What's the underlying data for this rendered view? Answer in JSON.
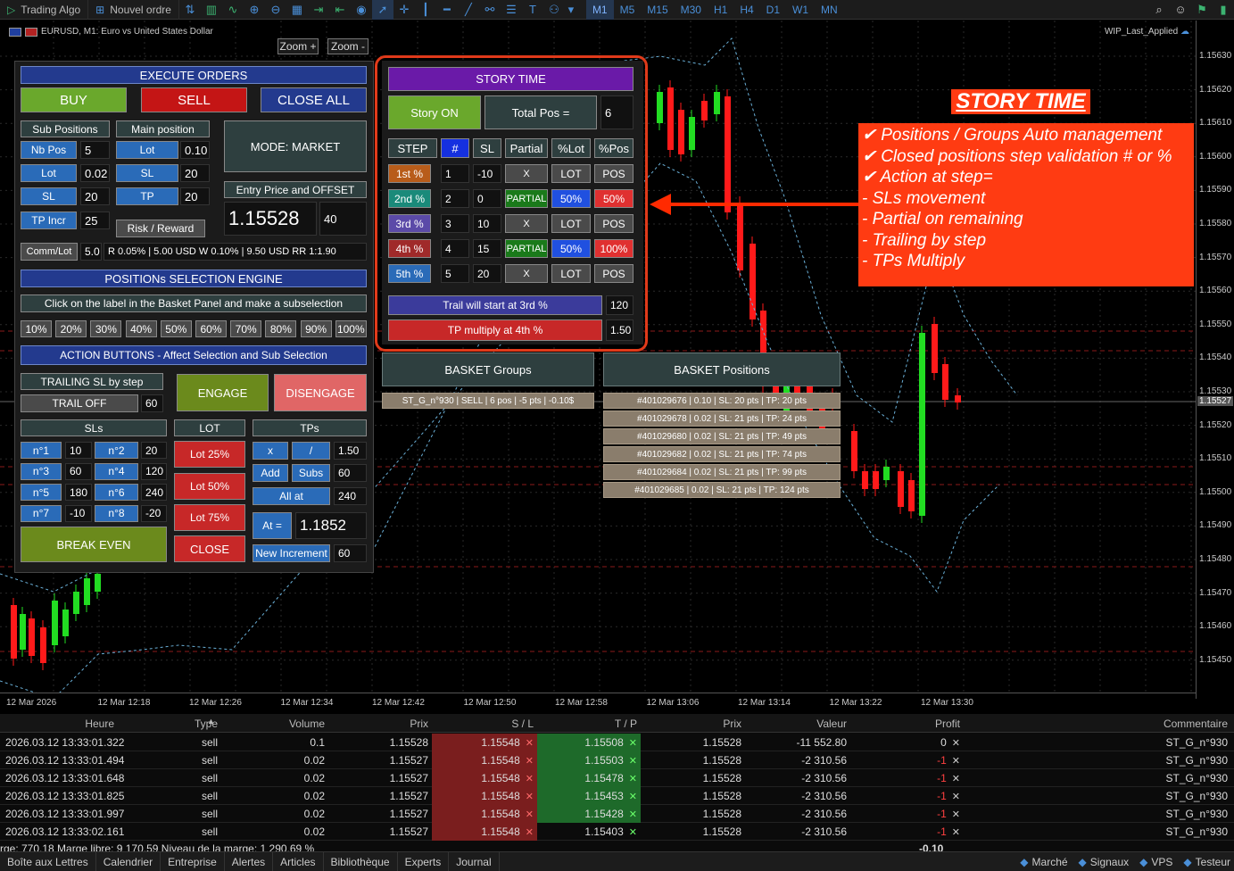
{
  "toolbar": {
    "trading_algo": "Trading Algo",
    "new_order": "Nouvel ordre",
    "timeframes": [
      "M1",
      "M5",
      "M15",
      "M30",
      "H1",
      "H4",
      "D1",
      "W1",
      "MN"
    ],
    "active_timeframe": "M1"
  },
  "chart": {
    "symbol_info": "EURUSD, M1:  Euro vs United States Dollar",
    "template": "WIP_Last_Applied",
    "zoom_in": "Zoom +",
    "zoom_out": "Zoom -",
    "price_labels": [
      "1.15630",
      "1.15620",
      "1.15610",
      "1.15600",
      "1.15590",
      "1.15580",
      "1.15570",
      "1.15560",
      "1.15550",
      "1.15540",
      "1.15530",
      "1.15520",
      "1.15510",
      "1.15500",
      "1.15490",
      "1.15480",
      "1.15470",
      "1.15460",
      "1.15450"
    ],
    "current_price": "1.15527",
    "time_labels": [
      "12 Mar 2026",
      "12 Mar 12:18",
      "12 Mar 12:26",
      "12 Mar 12:34",
      "12 Mar 12:42",
      "12 Mar 12:50",
      "12 Mar 12:58",
      "12 Mar 13:06",
      "12 Mar 13:14",
      "12 Mar 13:22",
      "12 Mar 13:30"
    ]
  },
  "execute": {
    "title": "EXECUTE ORDERS",
    "buy": "BUY",
    "sell": "SELL",
    "close_all": "CLOSE ALL",
    "sub_positions": "Sub Positions",
    "main_position": "Main position",
    "nb_pos_label": "Nb Pos",
    "nb_pos_value": "5",
    "lot_label": "Lot",
    "lot_value": "0.02",
    "sl_label": "SL",
    "sl_value": "20",
    "tp_incr_label": "TP Incr",
    "tp_incr_value": "25",
    "main_lot_label": "Lot",
    "main_lot_value": "0.10",
    "main_sl_label": "SL",
    "main_sl_value": "20",
    "main_tp_label": "TP",
    "main_tp_value": "20",
    "mode": "MODE: MARKET",
    "entry_price_offset": "Entry Price and OFFSET",
    "entry_price": "1.15528",
    "offset": "40",
    "risk_reward": "Risk / Reward",
    "comm_lot": "Comm/Lot",
    "comm_value": "5.0",
    "risk_summary": "R 0.05%  |  5.00 USD   W 0.10%  |  9.50 USD   RR 1:1.90"
  },
  "selection": {
    "title": "POSITIONs SELECTION ENGINE",
    "hint": "Click on the label in the Basket Panel and make a subselection",
    "percents": [
      "10%",
      "20%",
      "30%",
      "40%",
      "50%",
      "60%",
      "70%",
      "80%",
      "90%",
      "100%"
    ]
  },
  "actions": {
    "title": "ACTION BUTTONS - Affect Selection and Sub Selection",
    "trailing_sl": "TRAILING SL by step",
    "trail_off": "TRAIL OFF",
    "trail_value": "60",
    "engage": "ENGAGE",
    "disengage": "DISENGAGE",
    "sls_title": "SLs",
    "lot_title": "LOT",
    "tps_title": "TPs",
    "sl_grid": [
      {
        "l1": "n°1",
        "v1": "10",
        "l2": "n°2",
        "v2": "20"
      },
      {
        "l1": "n°3",
        "v1": "60",
        "l2": "n°4",
        "v2": "120"
      },
      {
        "l1": "n°5",
        "v1": "180",
        "l2": "n°6",
        "v2": "240"
      },
      {
        "l1": "n°7",
        "v1": "-10",
        "l2": "n°8",
        "v2": "-20"
      }
    ],
    "lot25": "Lot 25%",
    "lot50": "Lot 50%",
    "lot75": "Lot 75%",
    "close": "CLOSE",
    "tp_mul": "x",
    "tp_div": "/",
    "tp_mul_value": "1.50",
    "tp_add": "Add",
    "tp_subs": "Subs",
    "tp_add_value": "60",
    "tp_all_at": "All at",
    "tp_all_value": "240",
    "tp_at": "At =",
    "tp_at_value": "1.1852",
    "new_increment": "New Increment",
    "new_increment_value": "60",
    "break_even": "BREAK EVEN"
  },
  "story": {
    "title": "STORY TIME",
    "story_on": "Story ON",
    "total_pos": "Total Pos =",
    "total_pos_value": "6",
    "headers": [
      "STEP",
      "#",
      "SL",
      "Partial",
      "%Lot",
      "%Pos"
    ],
    "steps": [
      {
        "step": "1st %",
        "n": "1",
        "sl": "-10",
        "partial": "X",
        "lot": "LOT",
        "pos": "POS",
        "active": false
      },
      {
        "step": "2nd %",
        "n": "2",
        "sl": "0",
        "partial": "PARTIAL",
        "lot": "50%",
        "pos": "50%",
        "active": true
      },
      {
        "step": "3rd %",
        "n": "3",
        "sl": "10",
        "partial": "X",
        "lot": "LOT",
        "pos": "POS",
        "active": false
      },
      {
        "step": "4th %",
        "n": "4",
        "sl": "15",
        "partial": "PARTIAL",
        "lot": "50%",
        "pos": "100%",
        "active": true
      },
      {
        "step": "5th %",
        "n": "5",
        "sl": "20",
        "partial": "X",
        "lot": "LOT",
        "pos": "POS",
        "active": false
      }
    ],
    "trail_start": "Trail will start at 3rd %",
    "trail_start_value": "120",
    "tp_multiply": "TP multiply at 4th %",
    "tp_multiply_value": "1.50"
  },
  "basket": {
    "groups_title": "BASKET Groups",
    "positions_title": "BASKET Positions",
    "group_row": "ST_G_n°930 | SELL | 6 pos | -5 pts | -0.10$",
    "positions": [
      "#401029676 | 0.10 | SL: 20 pts | TP: 20 pts",
      "#401029678 | 0.02 | SL: 21 pts | TP: 24 pts",
      "#401029680 | 0.02 | SL: 21 pts | TP: 49 pts",
      "#401029682 | 0.02 | SL: 21 pts | TP: 74 pts",
      "#401029684 | 0.02 | SL: 21 pts | TP: 99 pts",
      "#401029685 | 0.02 | SL: 21 pts | TP: 124 pts"
    ]
  },
  "annotation": {
    "title": "STORY TIME",
    "lines": [
      "✔ Positions / Groups Auto management",
      "✔ Closed positions step validation # or %",
      "✔ Action at step=",
      " - SLs movement",
      " - Partial on remaining",
      " - Trailing by step",
      " - TPs Multiply"
    ]
  },
  "trades": {
    "headers": [
      "Heure",
      "Type",
      "Volume",
      "Prix",
      "S / L",
      "T / P",
      "Prix",
      "Valeur",
      "Profit",
      "Commentaire"
    ],
    "rows": [
      {
        "time": "2026.03.12 13:33:01.322",
        "type": "sell",
        "volume": "0.1",
        "price": "1.15528",
        "sl": "1.15548",
        "tp": "1.15508",
        "cur": "1.15528",
        "value": "-11 552.80",
        "profit": "0",
        "comment": "ST_G_n°930",
        "tp_hit": true
      },
      {
        "time": "2026.03.12 13:33:01.494",
        "type": "sell",
        "volume": "0.02",
        "price": "1.15527",
        "sl": "1.15548",
        "tp": "1.15503",
        "cur": "1.15528",
        "value": "-2 310.56",
        "profit": "-1",
        "comment": "ST_G_n°930",
        "tp_hit": true
      },
      {
        "time": "2026.03.12 13:33:01.648",
        "type": "sell",
        "volume": "0.02",
        "price": "1.15527",
        "sl": "1.15548",
        "tp": "1.15478",
        "cur": "1.15528",
        "value": "-2 310.56",
        "profit": "-1",
        "comment": "ST_G_n°930",
        "tp_hit": true
      },
      {
        "time": "2026.03.12 13:33:01.825",
        "type": "sell",
        "volume": "0.02",
        "price": "1.15527",
        "sl": "1.15548",
        "tp": "1.15453",
        "cur": "1.15528",
        "value": "-2 310.56",
        "profit": "-1",
        "comment": "ST_G_n°930",
        "tp_hit": true
      },
      {
        "time": "2026.03.12 13:33:01.997",
        "type": "sell",
        "volume": "0.02",
        "price": "1.15527",
        "sl": "1.15548",
        "tp": "1.15428",
        "cur": "1.15528",
        "value": "-2 310.56",
        "profit": "-1",
        "comment": "ST_G_n°930",
        "tp_hit": true
      },
      {
        "time": "2026.03.12 13:33:02.161",
        "type": "sell",
        "volume": "0.02",
        "price": "1.15527",
        "sl": "1.15548",
        "tp": "1.15403",
        "cur": "1.15528",
        "value": "-2 310.56",
        "profit": "-1",
        "comment": "ST_G_n°930",
        "tp_hit": false
      }
    ],
    "status": "rge: 770.18  Marge libre: 9 170.59  Niveau de la marge: 1 290.69 %",
    "total_profit": "-0.10"
  },
  "bottom_tabs": [
    "Boîte aux Lettres",
    "Calendrier",
    "Entreprise",
    "Alertes",
    "Articles",
    "Bibliothèque",
    "Experts",
    "Journal"
  ],
  "bottom_right": [
    "Marché",
    "Signaux",
    "VPS",
    "Testeur"
  ],
  "colors": {
    "buy": "#4f9d2f",
    "sell": "#c41515",
    "accent": "#233a8e",
    "annotation": "#ff3b12"
  }
}
